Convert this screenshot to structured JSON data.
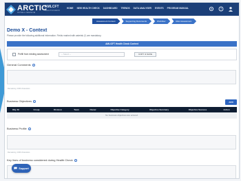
{
  "app": {
    "brand": "ARCTIC",
    "brand_sub": "INTELLIGENCE",
    "product": "AMLCFT",
    "product_sub": "HEALTHCHECK"
  },
  "nav": [
    "HOME",
    "NEW HEALTH CHECK",
    "DASHBOARD",
    "TRENDS",
    "DATA ANALYSER",
    "EVENTS",
    "PROGRAM MANUAL"
  ],
  "stepper": [
    "Assessment Context",
    "Supporting Documents",
    "Workflow",
    "Risk Assessment"
  ],
  "page": {
    "title": "Demo X - Context",
    "subtitle": "Please provide the following additional information. Fields marked with asterisk (*) are mandatory."
  },
  "section_title": "AML/CFT Health Check Context",
  "prefill": {
    "label": "Prefill from existing assessment",
    "select_placeholder": "-- Select --",
    "copy_button": "COPY & SAVE"
  },
  "general_comments": {
    "label": "General Comments",
    "counter": "Remaining: 1000 characters"
  },
  "business_objectives": {
    "label": "Business Objectives",
    "add_button": "ADD",
    "columns": [
      "Obj. Nr",
      "Group",
      "Division",
      "Team",
      "Owner",
      "Objective Category",
      "Objective Summary",
      "Objective Success",
      "Action"
    ],
    "empty_text": "No business objectives are entered."
  },
  "business_profile": {
    "label": "Business Profile",
    "counter": "Remaining: 1000 characters"
  },
  "key_lines": {
    "label": "Key lines of business considered during Health Check"
  },
  "support_button": "Support",
  "colors": {
    "topbar": "#1b3f78",
    "accent": "#3a72c7",
    "table_header": "#0f1e33"
  }
}
